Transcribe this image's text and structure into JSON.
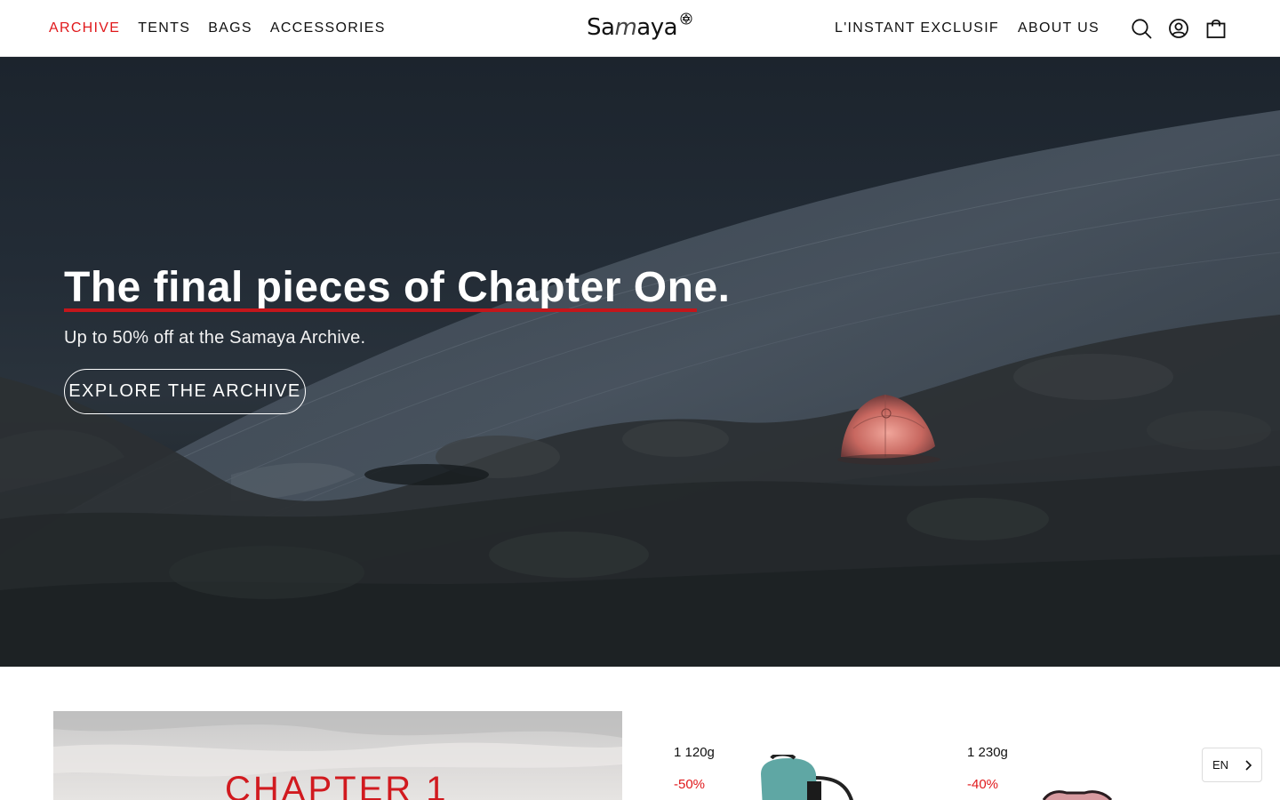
{
  "header": {
    "nav_left": [
      {
        "label": "ARCHIVE",
        "active": true
      },
      {
        "label": "TENTS",
        "active": false
      },
      {
        "label": "BAGS",
        "active": false
      },
      {
        "label": "ACCESSORIES",
        "active": false
      }
    ],
    "logo": {
      "text_before": "Sa",
      "text_styled": "m",
      "text_after": "aya"
    },
    "nav_right": [
      {
        "label": "L'INSTANT EXCLUSIF"
      },
      {
        "label": "ABOUT US"
      }
    ],
    "icons": [
      "search-icon",
      "account-icon",
      "cart-icon"
    ]
  },
  "hero": {
    "title": "The final pieces of Chapter One.",
    "subtitle": "Up to 50% off at the Samaya Archive.",
    "cta_label": "EXPLORE THE ARCHIVE"
  },
  "chapter": {
    "title": "CHAPTER 1"
  },
  "products": [
    {
      "weight": "1 120g",
      "discount": "-50%"
    },
    {
      "weight": "1 230g",
      "discount": "-40%"
    }
  ],
  "language": {
    "selected": "EN"
  },
  "colors": {
    "accent": "#e0181b",
    "underline": "#c4161b",
    "text": "#111111"
  }
}
